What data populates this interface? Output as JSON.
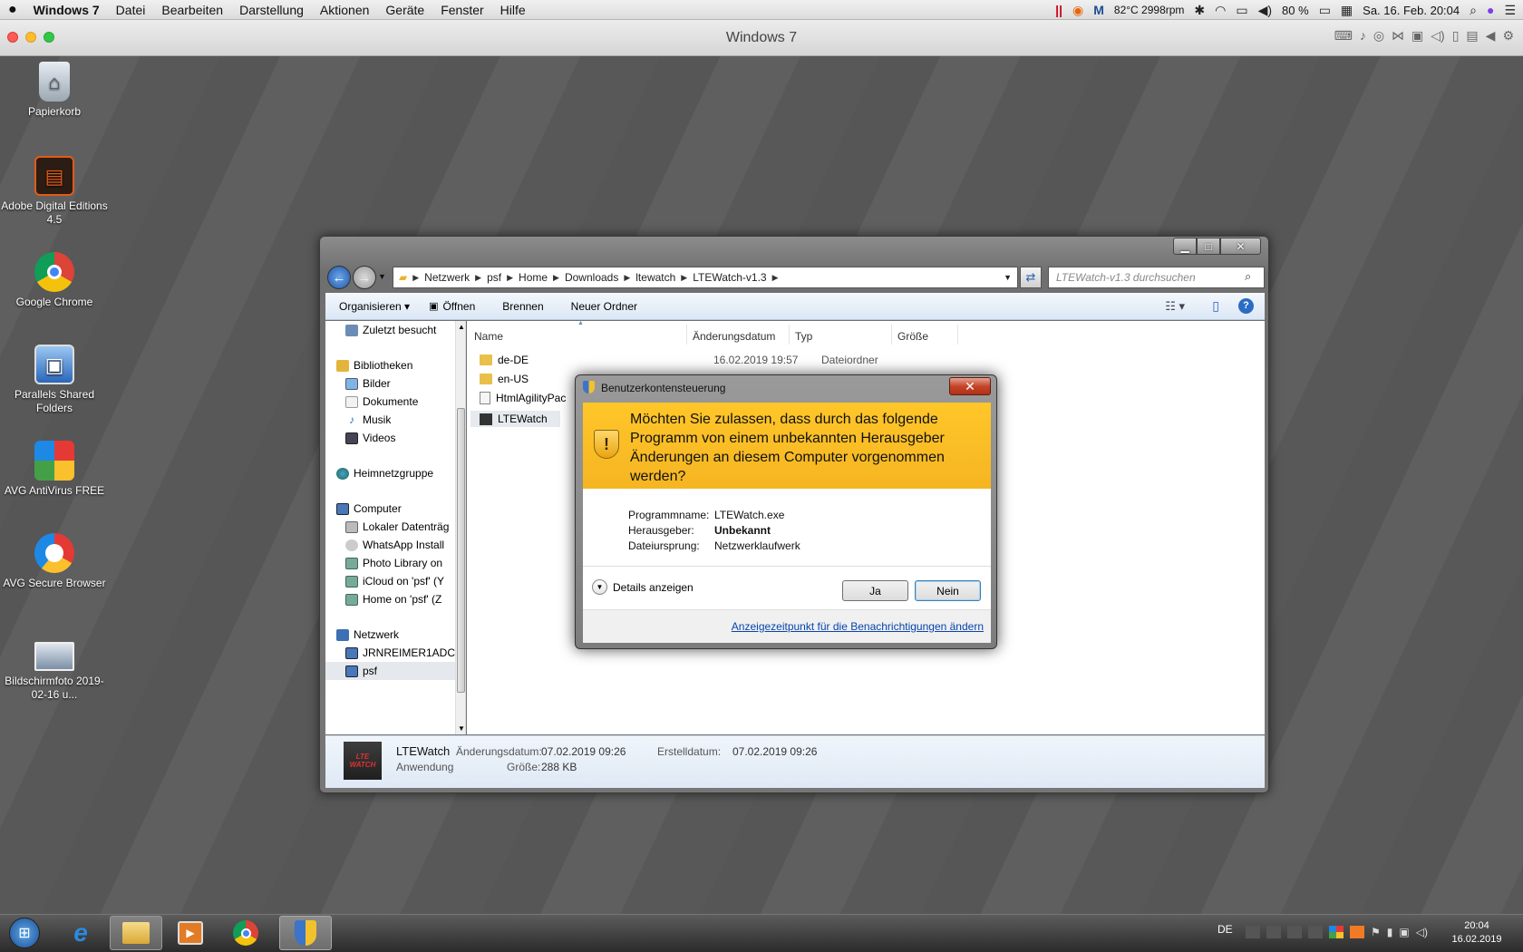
{
  "mac_menubar": {
    "app": "Windows 7",
    "items": [
      "Datei",
      "Bearbeiten",
      "Darstellung",
      "Aktionen",
      "Geräte",
      "Fenster",
      "Hilfe"
    ],
    "status": {
      "sensor": "82°C 2998rpm",
      "battery": "80 %",
      "datetime": "Sa. 16. Feb. 20:04"
    }
  },
  "parallels_title": "Windows 7",
  "desktop_icons": [
    {
      "label": "Papierkorb",
      "icon": "trash-icon"
    },
    {
      "label": "Adobe Digital Editions 4.5",
      "icon": "adobe-digital-editions-icon"
    },
    {
      "label": "Google Chrome",
      "icon": "chrome-icon"
    },
    {
      "label": "Parallels Shared Folders",
      "icon": "parallels-shared-folders-icon"
    },
    {
      "label": "AVG AntiVirus FREE",
      "icon": "avg-icon"
    },
    {
      "label": "AVG Secure Browser",
      "icon": "avg-browser-icon"
    },
    {
      "label": "Bildschirmfoto 2019-02-16 u...",
      "icon": "screenshot-file-icon"
    }
  ],
  "explorer": {
    "breadcrumb": [
      "Netzwerk",
      "psf",
      "Home",
      "Downloads",
      "ltewatch",
      "LTEWatch-v1.3"
    ],
    "search_placeholder": "LTEWatch-v1.3 durchsuchen",
    "commands": [
      "Organisieren ▾",
      "Öffnen",
      "Brennen",
      "Neuer Ordner"
    ],
    "nav": {
      "zuletzt": "Zuletzt besucht",
      "bibliotheken": "Bibliotheken",
      "libs": [
        "Bilder",
        "Dokumente",
        "Musik",
        "Videos"
      ],
      "heimnetz": "Heimnetzgruppe",
      "computer": "Computer",
      "drives": [
        "Lokaler Datenträg",
        "WhatsApp Install",
        "Photo Library on",
        "iCloud on 'psf' (Y",
        "Home on 'psf' (Z"
      ],
      "netzwerk": "Netzwerk",
      "net": [
        "JRNREIMER1ADC",
        "psf"
      ]
    },
    "columns": {
      "name": "Name",
      "date": "Änderungsdatum",
      "type": "Typ",
      "size": "Größe"
    },
    "files": [
      {
        "name": "de-DE",
        "date": "16.02.2019 19:57",
        "type": "Dateiordner"
      },
      {
        "name": "en-US",
        "date": "",
        "type": ""
      },
      {
        "name": "HtmlAgilityPac",
        "date": "",
        "type": ""
      },
      {
        "name": "LTEWatch",
        "date": "",
        "type": ""
      }
    ],
    "details": {
      "name": "LTEWatch",
      "kind": "Anwendung",
      "mod_label": "Änderungsdatum:",
      "mod_value": "07.02.2019 09:26",
      "size_label": "Größe:",
      "size_value": "288 KB",
      "created_label": "Erstelldatum:",
      "created_value": "07.02.2019 09:26",
      "thumb_text": "LTE WATCH"
    }
  },
  "uac": {
    "title": "Benutzerkontensteuerung",
    "question": "Möchten Sie zulassen, dass durch das folgende Programm von einem unbekannten Herausgeber Änderungen an diesem Computer vorgenommen werden?",
    "program_label": "Programmname:",
    "program_value": "LTEWatch.exe",
    "publisher_label": "Herausgeber:",
    "publisher_value": "Unbekannt",
    "origin_label": "Dateiursprung:",
    "origin_value": "Netzwerklaufwerk",
    "details": "Details anzeigen",
    "yes": "Ja",
    "no": "Nein",
    "link": "Anzeigezeitpunkt für die Benachrichtigungen ändern"
  },
  "taskbar": {
    "lang": "DE",
    "time": "20:04",
    "date": "16.02.2019"
  }
}
